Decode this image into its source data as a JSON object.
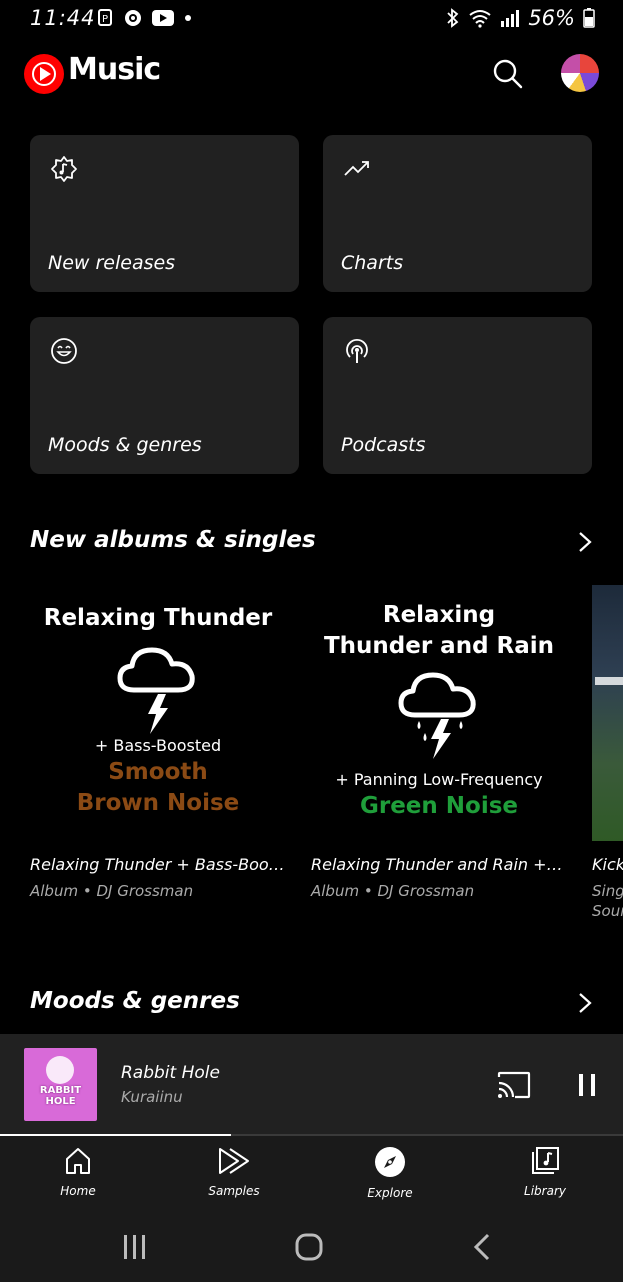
{
  "status_bar": {
    "time": "11:44",
    "battery": "56%"
  },
  "header": {
    "app_name": "Music",
    "icons": [
      "youtube-music-logo",
      "search-icon",
      "profile-avatar"
    ]
  },
  "tiles": [
    {
      "label": "New releases",
      "icon": "new-releases-icon"
    },
    {
      "label": "Charts",
      "icon": "trending-up-icon"
    },
    {
      "label": "Moods & genres",
      "icon": "smiley-icon"
    },
    {
      "label": "Podcasts",
      "icon": "podcast-icon"
    }
  ],
  "new_albums": {
    "title": "New albums & singles",
    "items": [
      {
        "cover": {
          "line1": "Relaxing Thunder",
          "line2": "+ Bass-Boosted",
          "line3": "Smooth",
          "line4": "Brown Noise"
        },
        "title": "Relaxing Thunder + Bass-Boost...",
        "subtitle": "Album • DJ Grossman",
        "accent": "#8b4a14"
      },
      {
        "cover": {
          "line1": "Relaxing",
          "line1b": "Thunder and Rain",
          "line2": "+ Panning Low-Frequency",
          "line3": "Green Noise"
        },
        "title": "Relaxing Thunder and Rain + P...",
        "subtitle": "Album • DJ Grossman",
        "accent": "#1f9e3a"
      },
      {
        "title": "Kick",
        "subtitle": "Sing",
        "subtitle2": "Sour"
      }
    ]
  },
  "moods": {
    "title": "Moods & genres"
  },
  "now_playing": {
    "title": "Rabbit Hole",
    "artist": "Kuraiinu",
    "art_text": "RABBIT HOLE",
    "progress": 0.37
  },
  "bottom_nav": [
    {
      "label": "Home",
      "icon": "home-icon"
    },
    {
      "label": "Samples",
      "icon": "samples-icon"
    },
    {
      "label": "Explore",
      "icon": "compass-icon"
    },
    {
      "label": "Library",
      "icon": "library-icon"
    }
  ],
  "colors": {
    "brand": "#ff0000",
    "tile_bg": "#212121",
    "player_bg": "#212121"
  }
}
